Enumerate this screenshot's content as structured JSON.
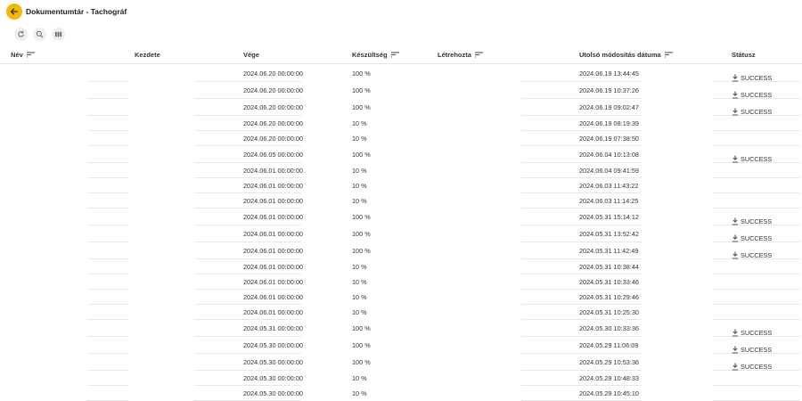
{
  "title": "Dokumentumtár - Tachográf",
  "icons": {
    "back": "arrow-left-icon",
    "refresh": "refresh-icon",
    "search": "search-icon",
    "columns": "columns-icon",
    "sort": "sort-icon",
    "download": "download-icon"
  },
  "colors": {
    "accent": "#f5b800",
    "border": "#e8e8e8"
  },
  "columns": [
    {
      "key": "nev",
      "label": "Név",
      "sortable": true
    },
    {
      "key": "kezdete",
      "label": "Kezdete",
      "sortable": false
    },
    {
      "key": "vege",
      "label": "Vége",
      "sortable": false
    },
    {
      "key": "keszultseg",
      "label": "Készültség",
      "sortable": true
    },
    {
      "key": "letrehozta",
      "label": "Létrehozta",
      "sortable": true
    },
    {
      "key": "utolso",
      "label": "Utolsó módosítás dátuma",
      "sortable": true
    },
    {
      "key": "statusz",
      "label": "Státusz",
      "sortable": false
    }
  ],
  "rows": [
    {
      "vege": "2024.06.20 00:00:00",
      "keszultseg": "100 %",
      "utolso": "2024.06.19 13:44:45",
      "status": "SUCCESS"
    },
    {
      "vege": "2024.06.20 00:00:00",
      "keszultseg": "100 %",
      "utolso": "2024.06.19 10:37:26",
      "status": "SUCCESS"
    },
    {
      "vege": "2024.06.20 00:00:00",
      "keszultseg": "100 %",
      "utolso": "2024.06.19 09:02:47",
      "status": "SUCCESS"
    },
    {
      "vege": "2024.06.20 00:00:00",
      "keszultseg": "10 %",
      "utolso": "2024.06.19 08:19:39",
      "status": ""
    },
    {
      "vege": "2024.06.20 00:00:00",
      "keszultseg": "10 %",
      "utolso": "2024.06.19 07:38:50",
      "status": ""
    },
    {
      "vege": "2024.06.05 00:00:00",
      "keszultseg": "100 %",
      "utolso": "2024.06.04 10:13:08",
      "status": "SUCCESS"
    },
    {
      "vege": "2024.06.01 00:00:00",
      "keszultseg": "10 %",
      "utolso": "2024.06.04 09:41:59",
      "status": ""
    },
    {
      "vege": "2024.06.01 00:00:00",
      "keszultseg": "10 %",
      "utolso": "2024.06.03 11:43:22",
      "status": ""
    },
    {
      "vege": "2024.06.01 00:00:00",
      "keszultseg": "10 %",
      "utolso": "2024.06.03 11:14:25",
      "status": ""
    },
    {
      "vege": "2024.06.01 00:00:00",
      "keszultseg": "100 %",
      "utolso": "2024.05.31 15:14:12",
      "status": "SUCCESS"
    },
    {
      "vege": "2024.06.01 00:00:00",
      "keszultseg": "100 %",
      "utolso": "2024.05.31 13:52:42",
      "status": "SUCCESS"
    },
    {
      "vege": "2024.06.01 00:00:00",
      "keszultseg": "100 %",
      "utolso": "2024.05.31 11:42:49",
      "status": "SUCCESS"
    },
    {
      "vege": "2024.06.01 00:00:00",
      "keszultseg": "10 %",
      "utolso": "2024.05.31 10:38:44",
      "status": ""
    },
    {
      "vege": "2024.06.01 00:00:00",
      "keszultseg": "10 %",
      "utolso": "2024.05.31 10:33:46",
      "status": ""
    },
    {
      "vege": "2024.06.01 00:00:00",
      "keszultseg": "10 %",
      "utolso": "2024.05.31 10:29:46",
      "status": ""
    },
    {
      "vege": "2024.06.01 00:00:00",
      "keszultseg": "10 %",
      "utolso": "2024.05.31 10:25:30",
      "status": ""
    },
    {
      "vege": "2024.05.31 00:00:00",
      "keszultseg": "100 %",
      "utolso": "2024.05.30 10:33:36",
      "status": "SUCCESS"
    },
    {
      "vege": "2024.05.30 00:00:00",
      "keszultseg": "100 %",
      "utolso": "2024.05.29 11:06:09",
      "status": "SUCCESS"
    },
    {
      "vege": "2024.05.30 00:00:00",
      "keszultseg": "100 %",
      "utolso": "2024.05.29 10:53:36",
      "status": "SUCCESS"
    },
    {
      "vege": "2024.05.30 00:00:00",
      "keszultseg": "10 %",
      "utolso": "2024.05.29 10:48:33",
      "status": ""
    },
    {
      "vege": "2024.05.30 00:00:00",
      "keszultseg": "10 %",
      "utolso": "2024.05.29 10:45:10",
      "status": ""
    }
  ]
}
